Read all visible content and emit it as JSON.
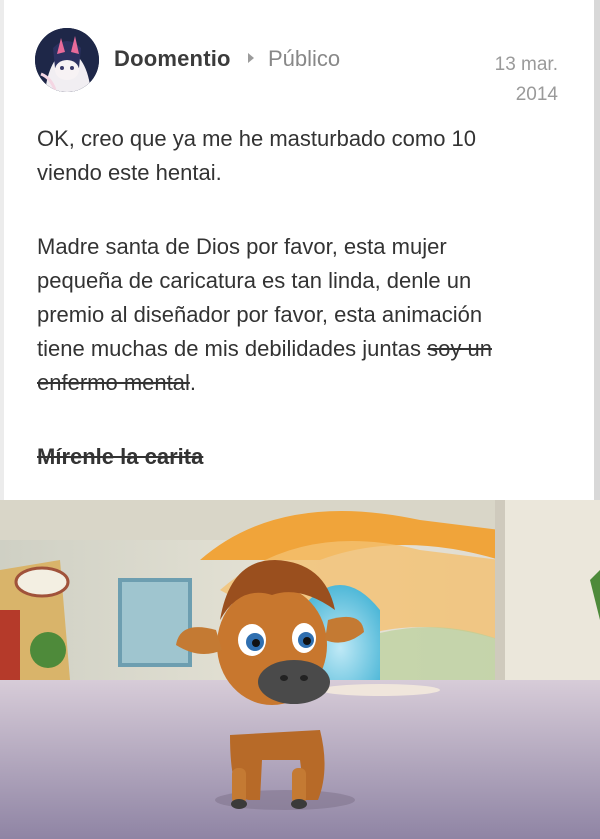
{
  "post": {
    "author": "Doomentio",
    "visibility": "Público",
    "date_line1": "13 mar.",
    "date_line2": "2014",
    "para1_line1": "OK, creo que ya me he masturbado como 10",
    "para1_line2": "viendo este hentai.",
    "para2_line1": "Madre santa de Dios por favor, esta mujer",
    "para2_line2": "pequeña de caricatura es tan linda, denle un",
    "para2_line3": "premio al diseñador por favor, esta animación",
    "para2_line4_plain": "tiene muchas de mis debilidades juntas ",
    "para2_line4_strike": "soy un",
    "para2_line5_strike": "enfermo mental",
    "para2_line5_end": ".",
    "para3_strike": "Mírenle la carita"
  },
  "icons": {
    "separator": "triangle-right",
    "avatar": "anime-avatar"
  },
  "colors": {
    "author": "#3b3b3b",
    "meta": "#888888",
    "body": "#333333",
    "calf": "#c8772e"
  }
}
